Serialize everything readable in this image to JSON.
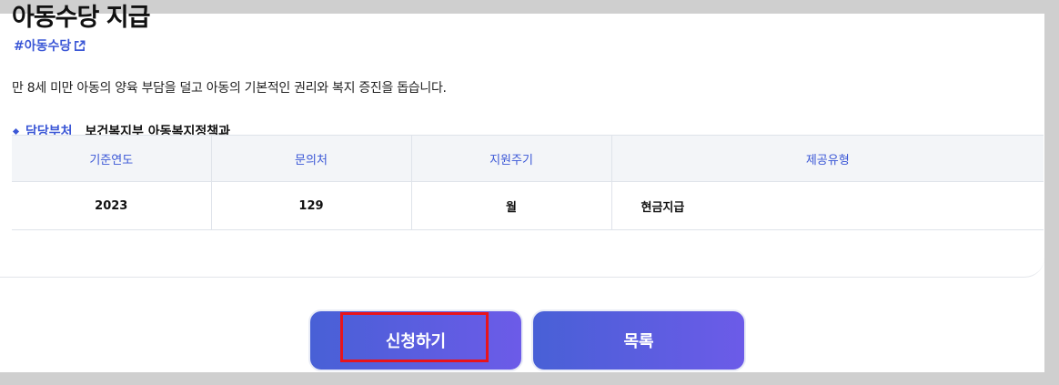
{
  "page": {
    "title": "아동수당 지급",
    "hashtag": "#아동수당",
    "description": "만 8세 미만 아동의 양육 부담을 덜고 아동의 기본적인 권리와 복지 증진을 돕습니다."
  },
  "department": {
    "label": "담당부처",
    "value": "보건복지부 아동복지정책과"
  },
  "info_table": {
    "headers": [
      "기준연도",
      "문의처",
      "지원주기",
      "제공유형"
    ],
    "row": [
      "2023",
      "129",
      "월",
      "현금지급"
    ]
  },
  "buttons": {
    "apply": "신청하기",
    "list": "목록"
  },
  "colors": {
    "accent": "#3b57d6",
    "button_gradient_start": "#4860d6",
    "button_gradient_end": "#6c5be8",
    "highlight": "#e8141c"
  },
  "icons": {
    "hashtag_link": "external-link-icon",
    "department_bullet": "diamond-bullet-icon"
  }
}
